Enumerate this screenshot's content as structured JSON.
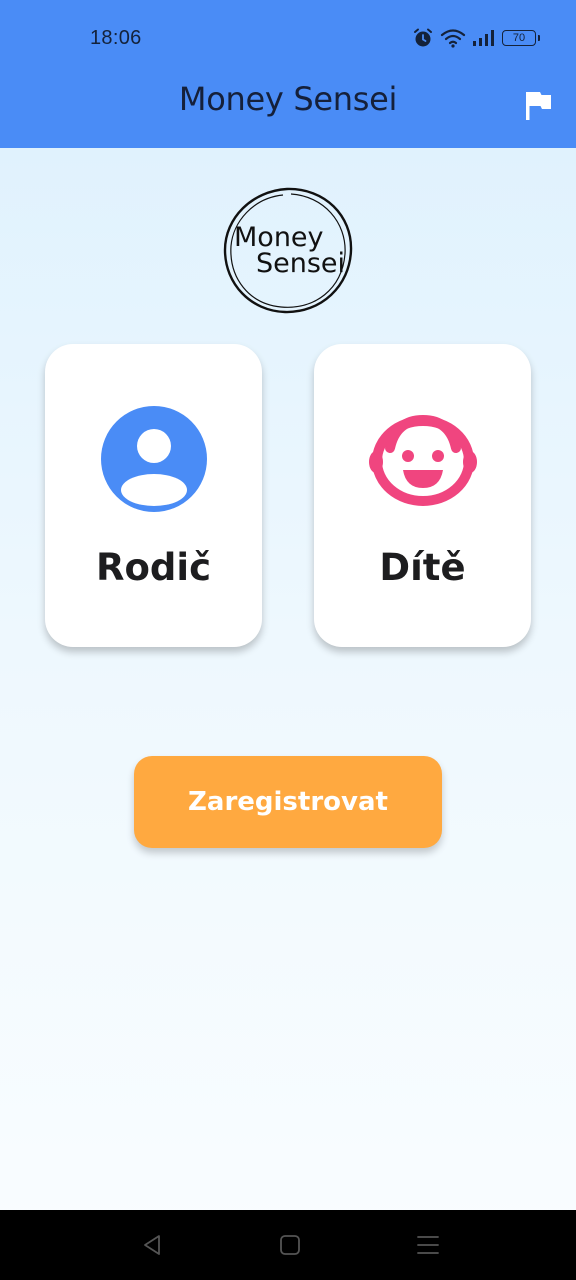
{
  "status_bar": {
    "time": "18:06",
    "battery": "70",
    "icons": [
      "alarm-icon",
      "wifi-icon",
      "signal-icon",
      "battery-icon"
    ]
  },
  "app_bar": {
    "title": "Money Sensei",
    "action_icon": "flag-icon"
  },
  "logo": {
    "line1": "Money",
    "line2": "Sensei"
  },
  "roles": [
    {
      "label": "Rodič",
      "icon": "person-icon",
      "color": "#4a8cf6"
    },
    {
      "label": "Dítě",
      "icon": "baby-face-icon",
      "color": "#f0457f"
    }
  ],
  "register": {
    "label": "Zaregistrovat",
    "color": "#ffa940"
  },
  "nav_bar": {
    "buttons": [
      "back-icon",
      "home-icon",
      "menu-icon"
    ]
  },
  "colors": {
    "app_bar": "#4a8cf6",
    "background": "#e2f3fd"
  }
}
